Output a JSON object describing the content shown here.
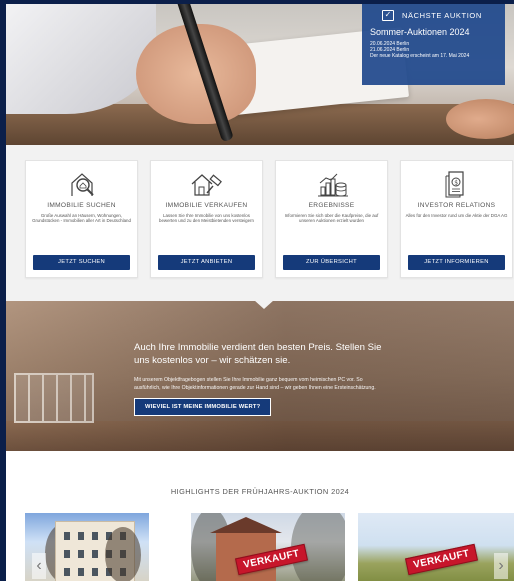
{
  "auction": {
    "title": "NÄCHSTE AUKTION",
    "subtitle": "Sommer-Auktionen 2024",
    "date1": "20.06.2024 Berlin",
    "date2": "21.06.2024 Berlin",
    "note": "Der neue Katalog erscheint am 17. Mai 2024"
  },
  "cards": [
    {
      "title": "IMMOBILIE SUCHEN",
      "desc": "Große Auswahl an Häusern, Wohnungen, Grundstücken - Immobilien aller Art in Deutschland",
      "button": "JETZT SUCHEN",
      "icon": "magnifier-house-icon"
    },
    {
      "title": "IMMOBILIE VERKAUFEN",
      "desc": "Lassen Sie Ihre Immobilie von uns kostenlos bewerten und zu den Meistbietenden versteigern",
      "button": "JETZT ANBIETEN",
      "icon": "house-gavel-icon"
    },
    {
      "title": "ERGEBNISSE",
      "desc": "Informieren Sie sich über die Kaufpreise, die auf unseren Auktionen erzielt wurden",
      "button": "ZUR ÜBERSICHT",
      "icon": "chart-coins-icon"
    },
    {
      "title": "INVESTOR RELATIONS",
      "desc": "Alles für den Investor rund um die Aktie der DGA AG",
      "button": "JETZT INFORMIEREN",
      "icon": "document-dollar-icon"
    }
  ],
  "banner": {
    "headline": "Auch Ihre Immobilie verdient den besten Preis. Stellen Sie uns kostenlos vor – wir schätzen sie.",
    "body": "Mit unserem Objektfragebogen stellen Sie Ihre Immobilie ganz bequem vom heimischen PC vor. So ausführlich, wie Ihre Objektinformationen gerade zur Hand sind – wir geben Ihnen eine Ersteinschätzung.",
    "button": "WIEVIEL IST MEINE IMMOBILIE WERT?"
  },
  "highlights": {
    "title": "HIGHLIGHTS DER FRÜHJAHRS-AUKTION 2024",
    "stamp1": "VERKAUFT",
    "stamp2": "VERKAUFT",
    "prev": "‹",
    "next": "›"
  },
  "colors": {
    "frame": "#0b1f4a",
    "primary": "#153a7a",
    "auction_box": "#1e488c",
    "sold": "#c7162b"
  }
}
